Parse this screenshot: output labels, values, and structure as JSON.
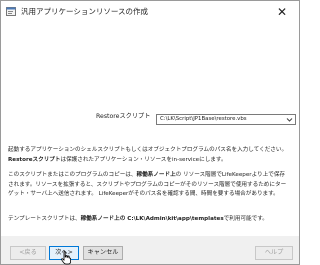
{
  "window": {
    "title": "汎用アプリケーションリソースの作成",
    "close_glyph": "✕"
  },
  "form": {
    "restore_label": "Restoreスクリプト",
    "restore_value": "C:\\LK\\Script\\JP1Base\\restore.vbs"
  },
  "description": {
    "p1_a": "起動するアプリケーションのシェルスクリプトもしくはオブジェクトプログラムのパス名を入力してください。",
    "p1_b": "Restoreスクリプト",
    "p1_c": "は保護されたアプリケーション・リソースをin-serviceにします。",
    "p2_a": "このスクリプトまたはこのプログラムのコピーは、",
    "p2_b": "稼働系ノード上",
    "p2_c": "の リソース階層でLifeKeeperより上で保存されます。リソースを拡張すると、スクリプトやプログラムのコピーがそのリソース階層で使用するためにターゲット・サーバ上へ送信されます。 LifeKeeperがそのパス名を確認する間、時間を要する場合があります。",
    "p3_a": "テンプレートスクリプトは、",
    "p3_b": "稼働系ノード上の C:\\LK\\Admin\\kit\\app\\templates",
    "p3_c": "で利用可能です。"
  },
  "buttons": {
    "back": "<戻る",
    "next": "次へ>",
    "cancel": "キャンセル",
    "help": "ヘルプ"
  },
  "colors": {
    "accent": "#0078d7",
    "window_bg": "#f0f0f0",
    "content_bg": "#ffffff"
  }
}
